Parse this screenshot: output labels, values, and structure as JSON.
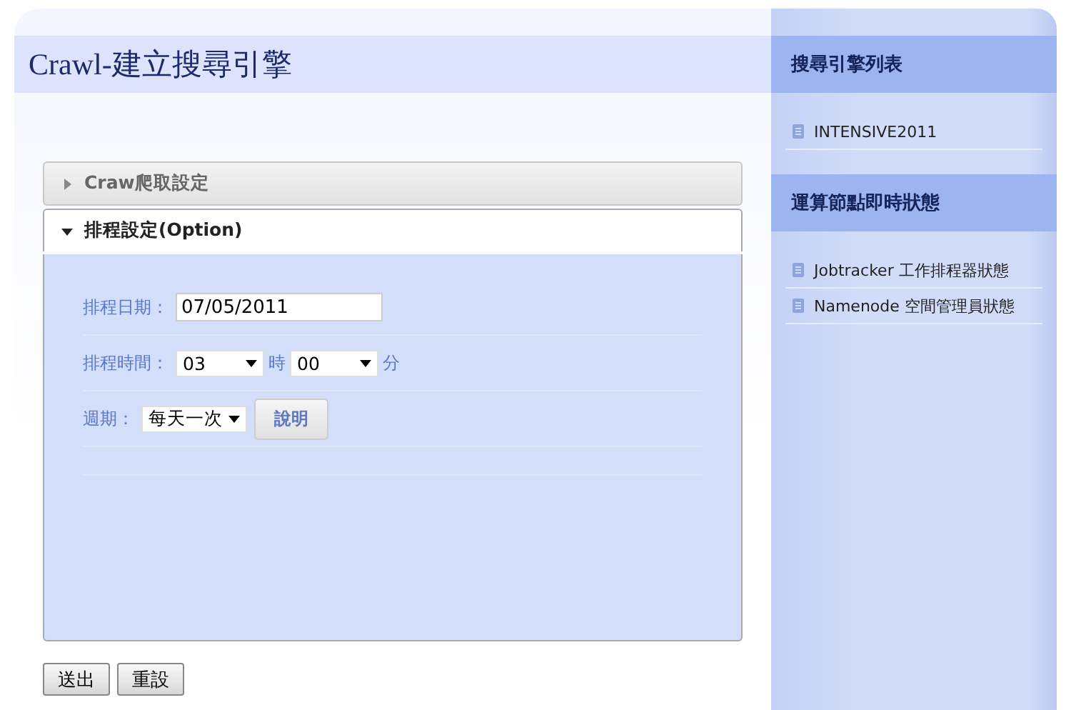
{
  "page": {
    "title": "Crawl-建立搜尋引擎"
  },
  "accordion": [
    {
      "title": "Craw爬取設定",
      "expanded": false
    },
    {
      "title": "排程設定(Option)",
      "expanded": true
    }
  ],
  "form": {
    "rows": [
      {
        "kind": "text",
        "label": "排程日期：",
        "value": "07/05/2011"
      },
      {
        "kind": "time",
        "label": "排程時間：",
        "hour": "03",
        "hour_unit": "時",
        "minute": "00",
        "minute_unit": "分"
      },
      {
        "kind": "select",
        "label": "週期：",
        "value": "每天一次",
        "button": "說明"
      }
    ]
  },
  "buttons": [
    "送出",
    "重設"
  ],
  "sidebar": {
    "sections": [
      {
        "title": "搜尋引擎列表",
        "items": [
          "INTENSIVE2011"
        ]
      },
      {
        "title": "運算節點即時狀態",
        "items": [
          "Jobtracker 工作排程器狀態",
          "Namenode 空間管理員狀態"
        ]
      }
    ]
  }
}
